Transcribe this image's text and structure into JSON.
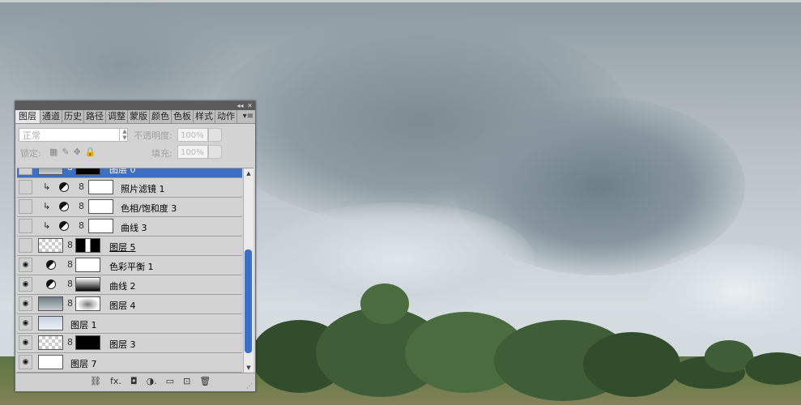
{
  "panel": {
    "title_buttons": [
      "◂◂",
      "✕"
    ],
    "tabs": [
      "图层",
      "通道",
      "历史",
      "路径",
      "调整",
      "蒙版",
      "颜色",
      "色板",
      "样式",
      "动作"
    ],
    "tab_menu": "▾≡",
    "blend_mode": "正常",
    "opacity_label": "不透明度:",
    "opacity_value": "100%",
    "lock_label": "锁定:",
    "fill_label": "填充:",
    "fill_value": "100%"
  },
  "layers": [
    {
      "name": "图层 0",
      "visible": false,
      "selected": true
    },
    {
      "name": "照片滤镜 1",
      "visible": false
    },
    {
      "name": "色相/饱和度 3",
      "visible": false
    },
    {
      "name": "曲线 3",
      "visible": false
    },
    {
      "name": "图层 5",
      "visible": false
    },
    {
      "name": "色彩平衡 1",
      "visible": true
    },
    {
      "name": "曲线 2",
      "visible": true
    },
    {
      "name": "图层 4",
      "visible": true
    },
    {
      "name": "图层 1",
      "visible": true
    },
    {
      "name": "图层 3",
      "visible": true
    },
    {
      "name": "图层 7",
      "visible": true
    }
  ],
  "icons": {
    "clip": "↳",
    "chain": "8",
    "lock_icons": [
      "▦",
      "✎",
      "✥",
      "🔒"
    ],
    "scroll_up": "▲",
    "scroll_down": "▼",
    "footer": [
      "⛓",
      "fx.",
      "◘",
      "◑.",
      "▭",
      "⊡",
      "🗑"
    ]
  }
}
